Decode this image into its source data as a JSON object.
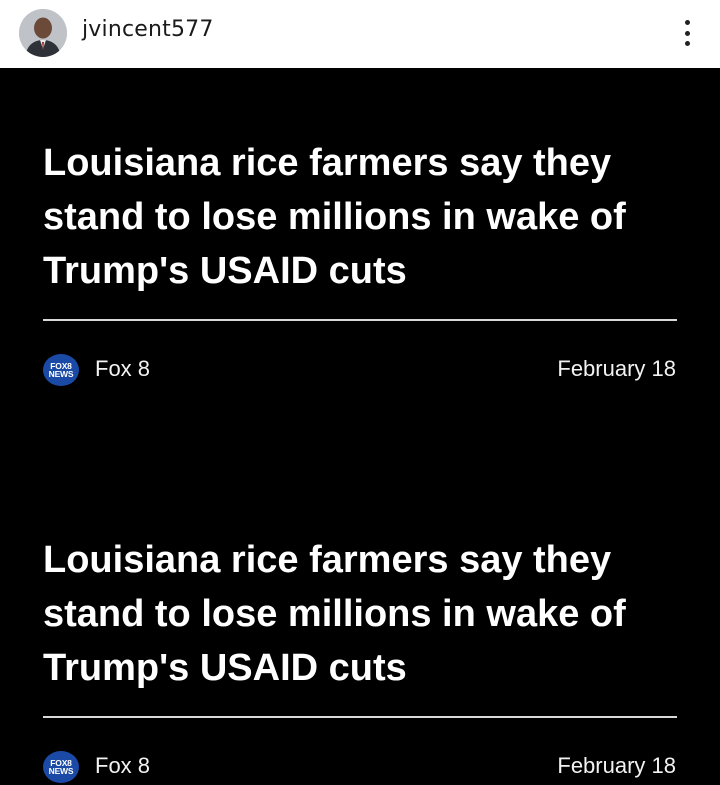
{
  "post": {
    "username": "jvincent577"
  },
  "cards": [
    {
      "headline": "Louisiana rice farmers say they stand to lose millions in wake of Trump's USAID cuts",
      "source_logo_line1": "FOX8",
      "source_logo_line2": "NEWS",
      "source": "Fox 8",
      "date": "February 18"
    },
    {
      "headline": "Louisiana rice farmers say they stand to lose millions in wake of Trump's USAID cuts",
      "source_logo_line1": "FOX8",
      "source_logo_line2": "NEWS",
      "source": "Fox 8",
      "date": "February 18"
    }
  ],
  "colors": {
    "media_background": "#000000",
    "logo_blue": "#1b4aa6"
  },
  "icons": [
    "more-vertical-icon",
    "fox8-news-logo"
  ]
}
